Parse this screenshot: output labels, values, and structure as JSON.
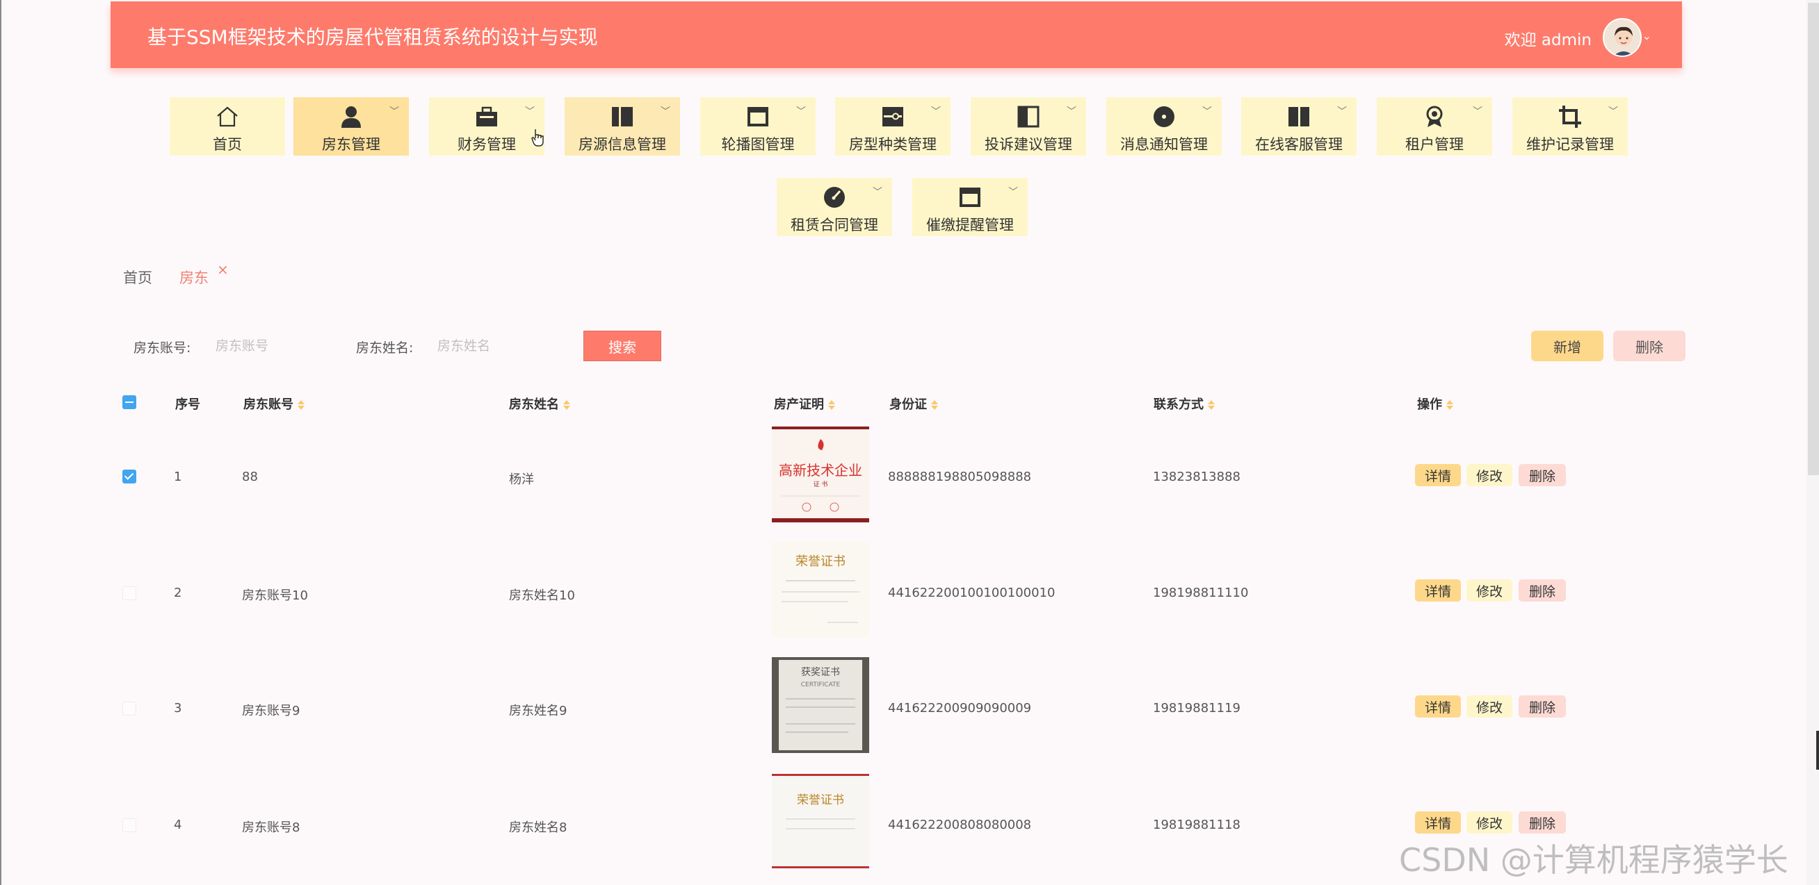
{
  "header": {
    "title": "基于SSM框架技术的房屋代管租赁系统的设计与实现",
    "welcome": "欢迎 admin",
    "caret": "⌄"
  },
  "menu": [
    {
      "label": "首页",
      "icon": "home-icon"
    },
    {
      "label": "房东管理",
      "icon": "user-icon"
    },
    {
      "label": "财务管理",
      "icon": "briefcase-icon"
    },
    {
      "label": "房源信息管理",
      "icon": "columns-icon"
    },
    {
      "label": "轮播图管理",
      "icon": "window-icon"
    },
    {
      "label": "房型种类管理",
      "icon": "toggle-icon"
    },
    {
      "label": "投诉建议管理",
      "icon": "sidebar-icon"
    },
    {
      "label": "消息通知管理",
      "icon": "record-icon"
    },
    {
      "label": "在线客服管理",
      "icon": "split-icon"
    },
    {
      "label": "租户管理",
      "icon": "award-icon"
    },
    {
      "label": "维护记录管理",
      "icon": "crop-icon"
    },
    {
      "label": "租赁合同管理",
      "icon": "gauge-icon"
    },
    {
      "label": "催缴提醒管理",
      "icon": "window-icon"
    }
  ],
  "breadcrumb": {
    "home": "首页",
    "current": "房东",
    "close": "×"
  },
  "search": {
    "account_label": "房东账号:",
    "account_placeholder": "房东账号",
    "name_label": "房东姓名:",
    "name_placeholder": "房东姓名",
    "search_button": "搜索"
  },
  "actions": {
    "add": "新增",
    "delete": "删除"
  },
  "table": {
    "headers": {
      "index": "序号",
      "account": "房东账号",
      "name": "房东姓名",
      "cert": "房产证明",
      "idcard": "身份证",
      "phone": "联系方式",
      "ops": "操作"
    },
    "row_buttons": {
      "detail": "详情",
      "edit": "修改",
      "delete": "删除"
    },
    "rows": [
      {
        "index": "1",
        "account": "88",
        "name": "杨洋",
        "idcard": "888888198805098888",
        "phone": "13823813888",
        "checked": true,
        "cert_title": "高新技术企业",
        "cert_sub": "证 书"
      },
      {
        "index": "2",
        "account": "房东账号10",
        "name": "房东姓名10",
        "idcard": "441622200100100100010",
        "phone": "198198811110",
        "checked": false,
        "cert_title": "荣誉证书",
        "cert_sub": ""
      },
      {
        "index": "3",
        "account": "房东账号9",
        "name": "房东姓名9",
        "idcard": "441622200909090009",
        "phone": "19819881119",
        "checked": false,
        "cert_title": "获奖证书",
        "cert_sub": "CERTIFICATE"
      },
      {
        "index": "4",
        "account": "房东账号8",
        "name": "房东姓名8",
        "idcard": "441622200808080008",
        "phone": "19819881118",
        "checked": false,
        "cert_title": "荣誉证书",
        "cert_sub": ""
      }
    ]
  },
  "watermark": "CSDN @计算机程序猿学长",
  "colors": {
    "header": "#fe7b6c",
    "menu": "#fef6c8",
    "menu_active": "#fde19c",
    "accent": "#f08070",
    "checkbox": "#41a5ef",
    "sort": "#fcc76a"
  }
}
